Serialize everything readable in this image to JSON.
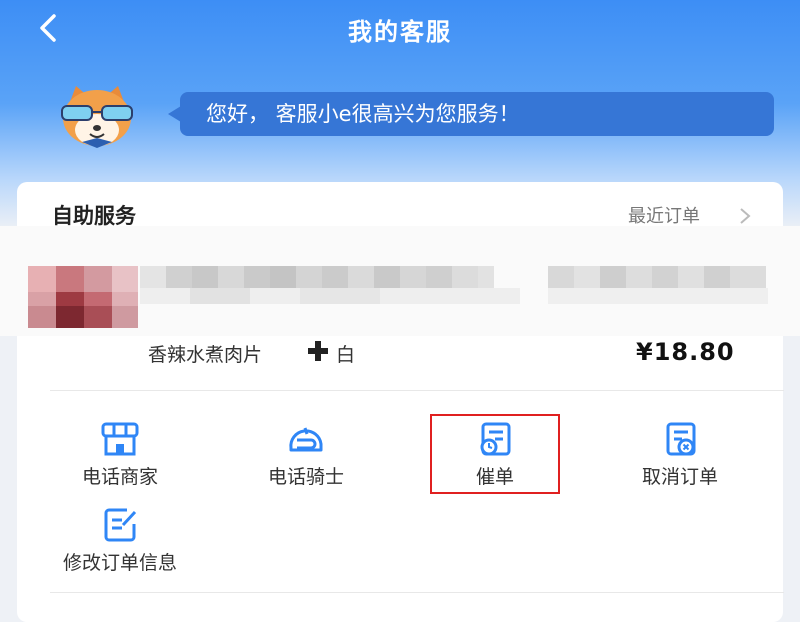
{
  "header": {
    "title": "我的客服",
    "greeting": "您好， 客服小e很高兴为您服务！"
  },
  "self_service": {
    "title": "自助服务",
    "recent_orders_label": "最近订单"
  },
  "order_item": {
    "name": "香辣水煮肉片",
    "suffix": "白",
    "price": "¥18.80"
  },
  "actions": [
    {
      "label": "电话商家",
      "icon": "store-icon"
    },
    {
      "label": "电话骑士",
      "icon": "rider-helmet-icon"
    },
    {
      "label": "催单",
      "icon": "urge-order-icon"
    },
    {
      "label": "取消订单",
      "icon": "cancel-order-icon"
    },
    {
      "label": "修改订单信息",
      "icon": "edit-order-icon"
    }
  ],
  "colors": {
    "accent": "#3d8ef5",
    "icon_blue": "#2f86f6",
    "highlight": "#e02020"
  }
}
